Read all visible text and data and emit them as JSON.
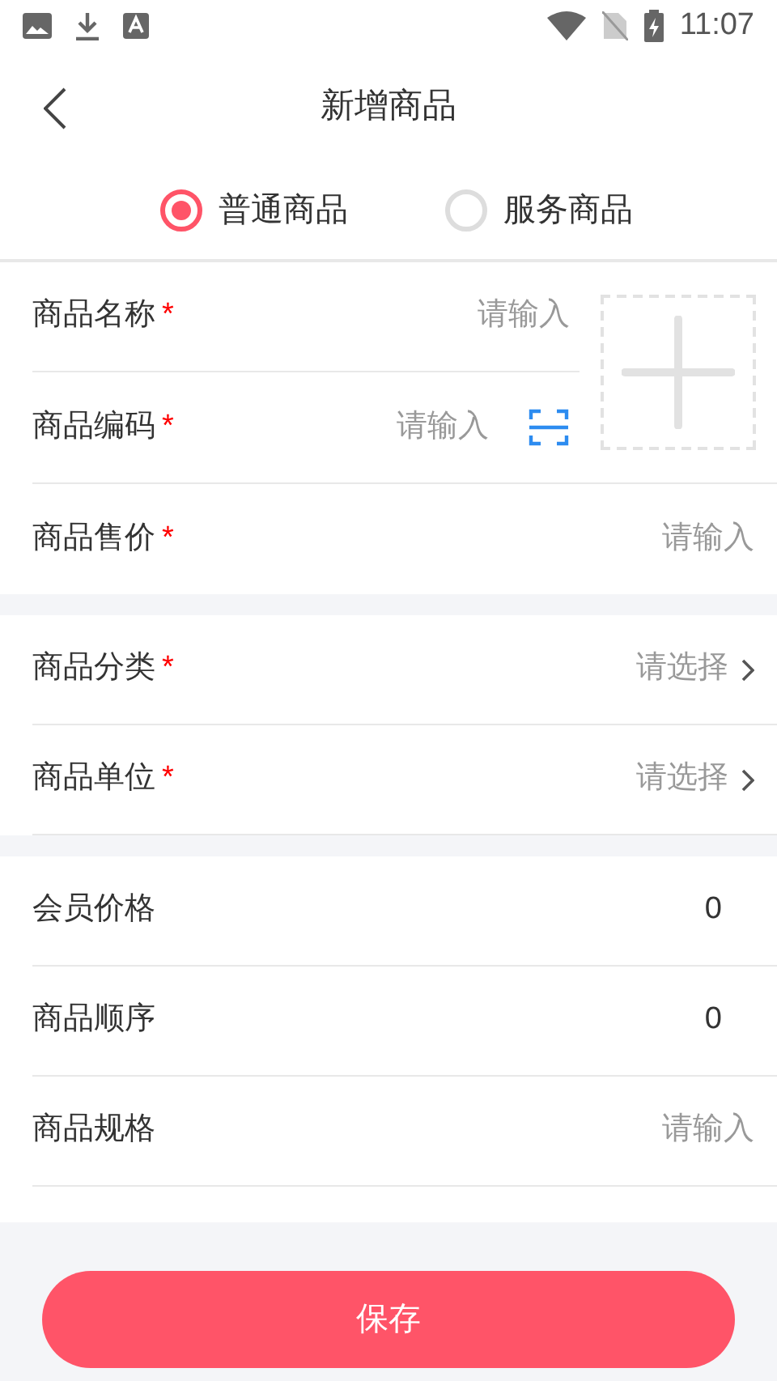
{
  "status_bar": {
    "time": "11:07"
  },
  "header": {
    "title": "新增商品"
  },
  "product_types": [
    {
      "label": "普通商品",
      "selected": true
    },
    {
      "label": "服务商品",
      "selected": false
    }
  ],
  "top_block": {
    "rows": [
      {
        "kind": "input",
        "label": "商品名称",
        "required_mark": "*",
        "placeholder": "请输入"
      },
      {
        "kind": "scan",
        "label": "商品编码",
        "required_mark": "*",
        "placeholder": "请输入"
      }
    ]
  },
  "sections": [
    {
      "rows": [
        {
          "kind": "input",
          "label": "商品售价",
          "required_mark": "*",
          "placeholder": "请输入"
        }
      ]
    },
    {
      "rows": [
        {
          "kind": "select",
          "label": "商品分类",
          "required_mark": "*",
          "placeholder": "请选择"
        },
        {
          "kind": "select",
          "label": "商品单位",
          "required_mark": "*",
          "placeholder": "请选择"
        }
      ]
    },
    {
      "rows": [
        {
          "kind": "value",
          "label": "会员价格",
          "value": "0"
        },
        {
          "kind": "value",
          "label": "商品顺序",
          "value": "0"
        },
        {
          "kind": "input",
          "label": "商品规格",
          "placeholder": "请输入"
        }
      ]
    }
  ],
  "save_button": {
    "label": "保存"
  }
}
